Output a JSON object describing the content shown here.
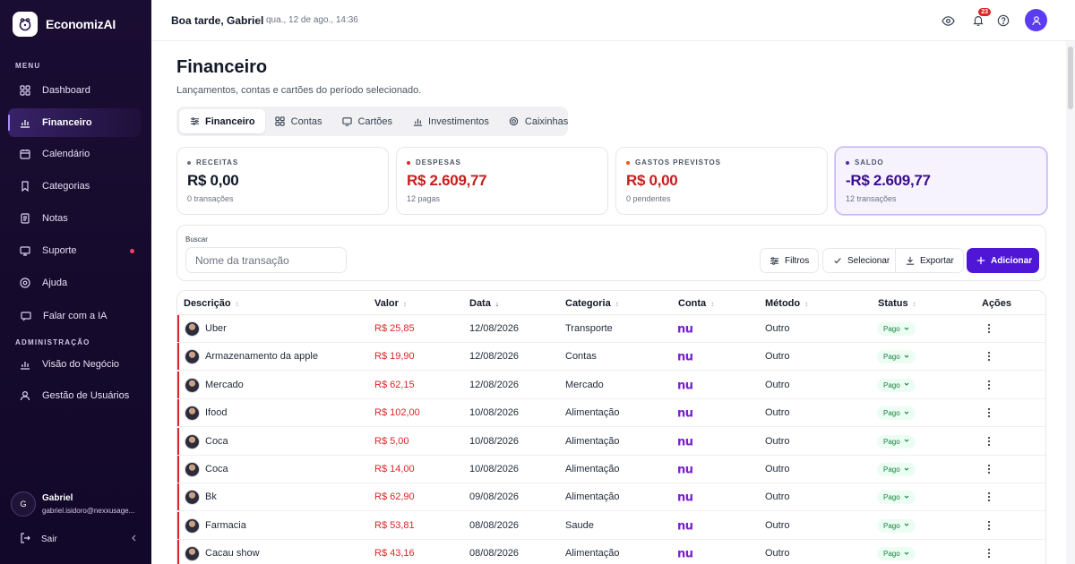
{
  "app": {
    "name": "EconomizAI"
  },
  "sidebar": {
    "menu_label": "MENU",
    "admin_label": "ADMINISTRAÇÃO",
    "items": [
      {
        "label": "Dashboard",
        "icon": "grid-icon",
        "active": false
      },
      {
        "label": "Financeiro",
        "icon": "bar-chart-icon",
        "active": true
      },
      {
        "label": "Calendário",
        "icon": "calendar-icon",
        "active": false
      },
      {
        "label": "Categorias",
        "icon": "bookmark-icon",
        "active": false
      },
      {
        "label": "Notas",
        "icon": "note-icon",
        "active": false
      },
      {
        "label": "Suporte",
        "icon": "message-icon",
        "active": false,
        "has_dot": true
      },
      {
        "label": "Ajuda",
        "icon": "help-circle-icon",
        "active": false
      },
      {
        "label": "Falar com a IA",
        "icon": "chat-icon",
        "active": false
      }
    ],
    "admin_items": [
      {
        "label": "Visão do Negócio",
        "icon": "bar-chart-icon"
      },
      {
        "label": "Gestão de Usuários",
        "icon": "user-icon"
      }
    ],
    "user": {
      "initial": "G",
      "name": "Gabriel",
      "email": "gabriel.isidoro@nexxusage..."
    },
    "logout_label": "Sair"
  },
  "header": {
    "greeting": "Boa tarde, Gabriel",
    "separator": "·",
    "datetime": "qua., 12 de ago., 14:36",
    "notification_count": "23"
  },
  "page": {
    "title": "Financeiro",
    "subtitle": "Lançamentos, contas e cartões do período selecionado."
  },
  "tabs": [
    {
      "label": "Financeiro",
      "icon": "sliders-icon",
      "active": true
    },
    {
      "label": "Contas",
      "icon": "grid-icon",
      "active": false
    },
    {
      "label": "Cartões",
      "icon": "card-icon",
      "active": false
    },
    {
      "label": "Investimentos",
      "icon": "bar-chart-icon",
      "active": false
    },
    {
      "label": "Caixinhas",
      "icon": "piggy-icon",
      "active": false
    }
  ],
  "summary": [
    {
      "label": "RECEITAS",
      "value": "R$ 0,00",
      "sub": "0 transações",
      "dot_color": "#6b7280",
      "value_color": "#111827"
    },
    {
      "label": "DESPESAS",
      "value": "R$ 2.609,77",
      "sub": "12 pagas",
      "dot_color": "#dc2626",
      "value_color": "#c81e1e"
    },
    {
      "label": "GASTOS PREVISTOS",
      "value": "R$ 0,00",
      "sub": "0 pendentes",
      "dot_color": "#ea580c",
      "value_color": "#c81e1e"
    },
    {
      "label": "SALDO",
      "value": "-R$ 2.609,77",
      "sub": "12 transações",
      "dot_color": "#5b21b6",
      "value_color": "#3b0d8f"
    }
  ],
  "search": {
    "label": "Buscar",
    "placeholder": "Nome da transação",
    "filters_label": "Filtros",
    "select_label": "Selecionar",
    "export_label": "Exportar",
    "add_label": "Adicionar"
  },
  "table": {
    "columns": [
      "Descrição",
      "Valor",
      "Data",
      "Categoria",
      "Conta",
      "Método",
      "Status",
      "Ações"
    ],
    "sort_marks": [
      "↕",
      "↕",
      "↓",
      "↕",
      "↕",
      "↕",
      "↕",
      ""
    ],
    "account_logo": "nu",
    "rows": [
      {
        "descricao": "Uber",
        "valor": "R$ 25,85",
        "data": "12/08/2026",
        "categoria": "Transporte",
        "metodo": "Outro",
        "status": "Pago"
      },
      {
        "descricao": "Armazenamento da apple",
        "valor": "R$ 19,90",
        "data": "12/08/2026",
        "categoria": "Contas",
        "metodo": "Outro",
        "status": "Pago"
      },
      {
        "descricao": "Mercado",
        "valor": "R$ 62,15",
        "data": "12/08/2026",
        "categoria": "Mercado",
        "metodo": "Outro",
        "status": "Pago"
      },
      {
        "descricao": "Ifood",
        "valor": "R$ 102,00",
        "data": "10/08/2026",
        "categoria": "Alimentação",
        "metodo": "Outro",
        "status": "Pago"
      },
      {
        "descricao": "Coca",
        "valor": "R$ 5,00",
        "data": "10/08/2026",
        "categoria": "Alimentação",
        "metodo": "Outro",
        "status": "Pago"
      },
      {
        "descricao": "Coca",
        "valor": "R$ 14,00",
        "data": "10/08/2026",
        "categoria": "Alimentação",
        "metodo": "Outro",
        "status": "Pago"
      },
      {
        "descricao": "Bk",
        "valor": "R$ 62,90",
        "data": "09/08/2026",
        "categoria": "Alimentação",
        "metodo": "Outro",
        "status": "Pago"
      },
      {
        "descricao": "Farmacia",
        "valor": "R$ 53,81",
        "data": "08/08/2026",
        "categoria": "Saude",
        "metodo": "Outro",
        "status": "Pago"
      },
      {
        "descricao": "Cacau show",
        "valor": "R$ 43,16",
        "data": "08/08/2026",
        "categoria": "Alimentação",
        "metodo": "Outro",
        "status": "Pago"
      }
    ]
  },
  "colors": {
    "accent": "#4f16d6",
    "sidebar_bg": "#1a0d33",
    "expense": "#dc2626",
    "status_paid": "#15803d"
  }
}
